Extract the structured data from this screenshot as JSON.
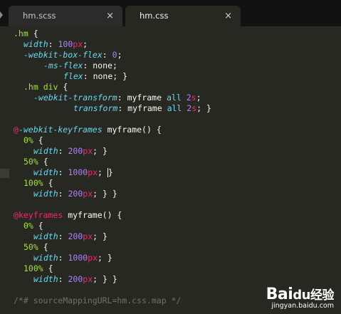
{
  "tabs": [
    {
      "label": "hm.scss",
      "close": "×",
      "active": false
    },
    {
      "label": "hm.css",
      "close": "×",
      "active": true
    }
  ],
  "code": {
    "l1_sel": ".hm",
    "l1_brace": " {",
    "width": "width",
    "n100": "100",
    "px": "px",
    "wbf": "-webkit-box-flex",
    "n0": "0",
    "msflex": "-ms-flex",
    "none": "none",
    "flex": "flex",
    "l6_sel": ".hm div",
    "wtransform": "-webkit-transform",
    "transform": "transform",
    "myframe": "myframe",
    "all": "all",
    "n2": "2",
    "s": "s",
    "at": "@",
    "wkeyframes": "-webkit-keyframes",
    "keyframes": "keyframes",
    "myframe_call": "myframe()",
    "pct0": "0%",
    "pct50": "50%",
    "pct100": "100%",
    "n200": "200",
    "n1000": "1000",
    "comment": "/*# sourceMappingURL=hm.css.map */"
  },
  "watermark": {
    "logo_a": "Bai",
    "logo_paw": "du",
    "logo_b": "经验",
    "url": "jingyan.baidu.com"
  }
}
